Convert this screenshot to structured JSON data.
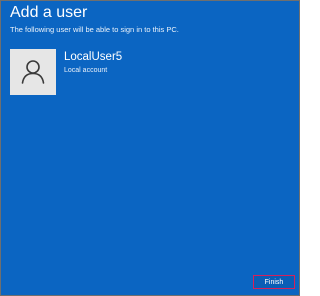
{
  "dialog": {
    "title": "Add a user",
    "subtitle": "The following user will be able to sign in to this PC."
  },
  "user": {
    "name": "LocalUser5",
    "account_type": "Local account",
    "avatar_icon": "person-icon"
  },
  "actions": {
    "finish_label": "Finish"
  },
  "colors": {
    "background": "#0b65c2",
    "avatar_background": "#e6e6e6",
    "finish_highlight_border": "#d6205b"
  }
}
